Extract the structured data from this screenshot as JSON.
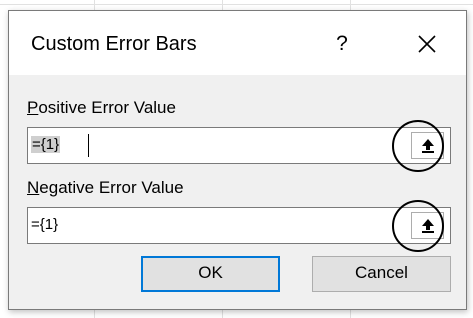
{
  "dialog": {
    "title": "Custom Error Bars",
    "help_glyph": "?",
    "close_icon": "close-icon"
  },
  "positive": {
    "label_accel": "P",
    "label_rest": "ositive Error Value",
    "value": "={1}"
  },
  "negative": {
    "label_accel": "N",
    "label_rest": "egative Error Value",
    "value": "={1}"
  },
  "buttons": {
    "ok": "OK",
    "cancel": "Cancel"
  },
  "colors": {
    "default_button_border": "#0078d7",
    "annotation_ring": "#000000"
  }
}
